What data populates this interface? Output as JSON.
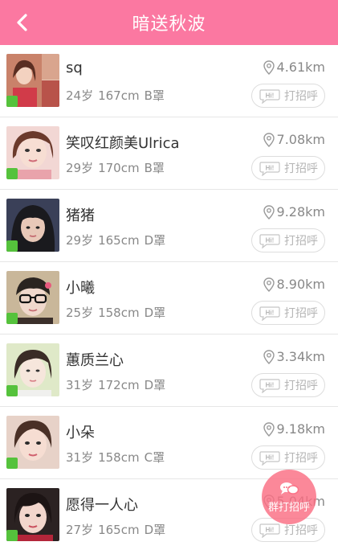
{
  "header": {
    "title": "暗送秋波"
  },
  "icons": {
    "back": "chevron-left-icon",
    "location": "location-pin-icon",
    "hi": "hi-bubble-icon",
    "chat": "chat-bubbles-icon"
  },
  "colors": {
    "header": "#fb78a1",
    "online": "#55c23c",
    "fab": "#fa6e82"
  },
  "greet_label": "打招呼",
  "fab_label": "群打招呼",
  "users": [
    {
      "name": "sq",
      "age": "24岁",
      "height": "167cm",
      "cup": "B罩",
      "distance": "4.61km"
    },
    {
      "name": "笑叹红颜美Ulrica",
      "age": "29岁",
      "height": "170cm",
      "cup": "B罩",
      "distance": "7.08km"
    },
    {
      "name": "猪猪",
      "age": "29岁",
      "height": "165cm",
      "cup": "D罩",
      "distance": "9.28km"
    },
    {
      "name": "小曦",
      "age": "25岁",
      "height": "158cm",
      "cup": "D罩",
      "distance": "8.90km"
    },
    {
      "name": "蕙质兰心",
      "age": "31岁",
      "height": "172cm",
      "cup": "D罩",
      "distance": "3.34km"
    },
    {
      "name": "小朵",
      "age": "31岁",
      "height": "158cm",
      "cup": "C罩",
      "distance": "9.18km"
    },
    {
      "name": "愿得一人心",
      "age": "27岁",
      "height": "165cm",
      "cup": "D罩",
      "distance": "5.04km"
    }
  ]
}
